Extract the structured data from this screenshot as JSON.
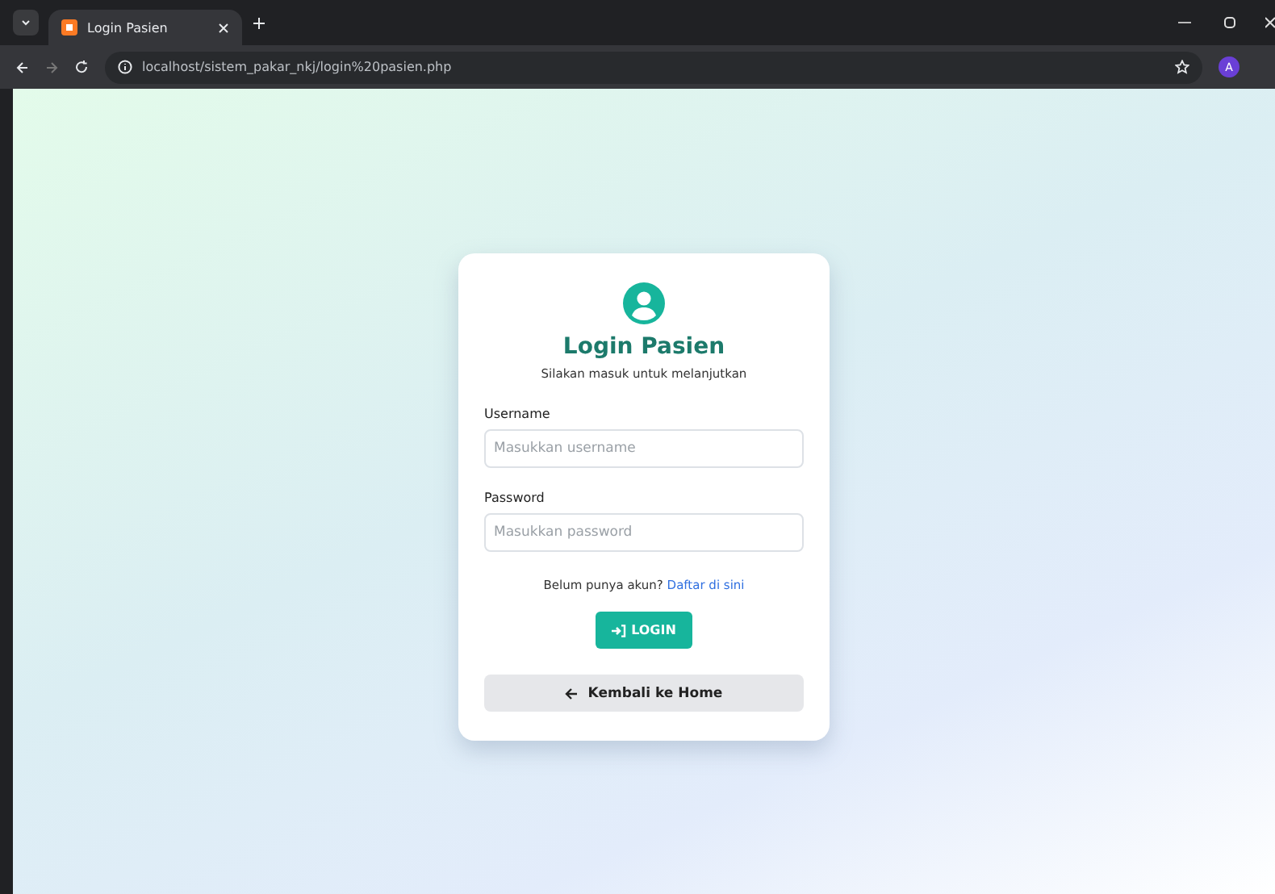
{
  "browser": {
    "tab_title": "Login Pasien",
    "url": "localhost/sistem_pakar_nkj/login%20pasien.php",
    "profile_initial": "A"
  },
  "card": {
    "title": "Login Pasien",
    "subtitle": "Silakan masuk untuk melanjutkan",
    "fields": [
      {
        "label": "Username",
        "placeholder": "Masukkan username"
      },
      {
        "label": "Password",
        "placeholder": "Masukkan password"
      }
    ],
    "register_prompt": "Belum punya akun?",
    "register_link": "Daftar di sini",
    "login_button": "LOGIN",
    "back_button": "Kembali ke Home"
  }
}
